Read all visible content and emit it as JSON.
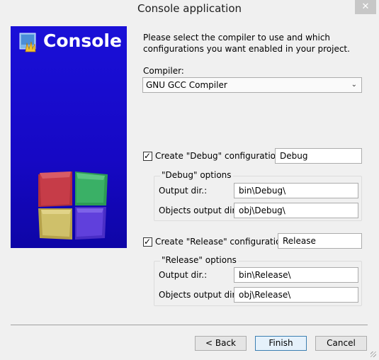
{
  "window": {
    "title": "Console application",
    "close_label": "✕"
  },
  "banner": {
    "title": "Console"
  },
  "description": "Please select the compiler to use and which configurations you want enabled in your project.",
  "compiler": {
    "label": "Compiler:",
    "selected": "GNU GCC Compiler"
  },
  "debug": {
    "checked": true,
    "checkbox_label": "Create \"Debug\" configuration:",
    "name_value": "Debug",
    "group_title": "\"Debug\" options",
    "output_dir_label": "Output dir.:",
    "output_dir_value": "bin\\Debug\\",
    "objects_dir_label": "Objects output dir.:",
    "objects_dir_value": "obj\\Debug\\"
  },
  "release": {
    "checked": true,
    "checkbox_label": "Create \"Release\" configuration:",
    "name_value": "Release",
    "group_title": "\"Release\" options",
    "output_dir_label": "Output dir.:",
    "output_dir_value": "bin\\Release\\",
    "objects_dir_label": "Objects output dir.:",
    "objects_dir_value": "obj\\Release\\"
  },
  "buttons": {
    "back": "< Back",
    "finish": "Finish",
    "cancel": "Cancel"
  },
  "colors": {
    "banner": "#1608c4",
    "default_button_border": "#3c7fb1"
  },
  "icons": {
    "logo": "codeblocks-logo-icon",
    "cubes": "codeblocks-cubes-icon"
  }
}
